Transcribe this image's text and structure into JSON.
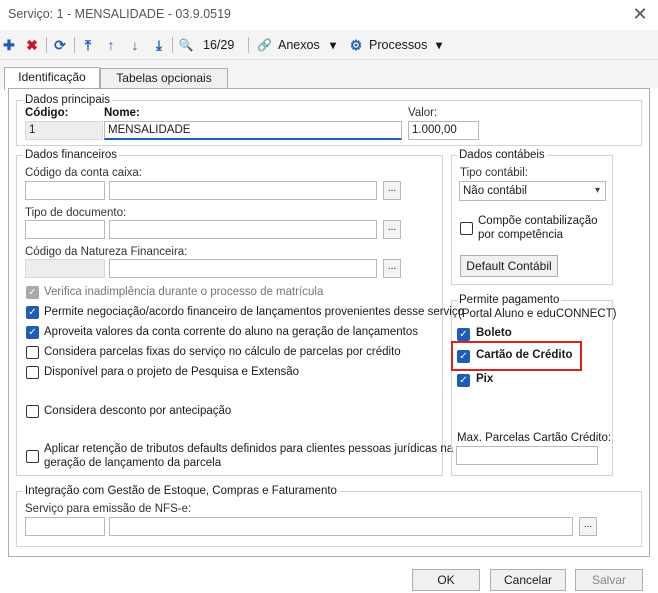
{
  "window": {
    "title": "Serviço: 1 - MENSALIDADE - 03.9.0519",
    "close_glyph": "✕"
  },
  "toolbar": {
    "add_glyph": "✚",
    "delete_glyph": "✖",
    "refresh_glyph": "⟳",
    "first_glyph": "⤒",
    "prev_glyph": "↑",
    "next_glyph": "↓",
    "last_glyph": "⤓",
    "search_glyph": "🔍",
    "record_counter": "16/29",
    "attach_glyph": "🔗",
    "attachments_label": "Anexos",
    "dropdown_glyph": "▾",
    "process_glyph": "⚙",
    "processes_label": "Processos"
  },
  "tabs": [
    {
      "label": "Identificação"
    },
    {
      "label": "Tabelas opcionais"
    }
  ],
  "main_data": {
    "group_label": "Dados principais",
    "code_label": "Código:",
    "code_value": "1",
    "name_label": "Nome:",
    "name_value": "MENSALIDADE",
    "value_label": "Valor:",
    "value_value": "1.000,00"
  },
  "financial": {
    "group_label": "Dados financeiros",
    "cash_account_label": "Código da conta caixa:",
    "document_type_label": "Tipo de documento:",
    "nature_label": "Código da Natureza Financeira:",
    "lookup_glyph": "...",
    "options": [
      {
        "label": "Verifica inadimplência durante o processo de matrícula",
        "checked": true,
        "disabled": true
      },
      {
        "label": "Permite negociação/acordo financeiro de lançamentos provenientes desse serviço",
        "checked": true,
        "disabled": false
      },
      {
        "label": "Aproveita valores da conta corrente do aluno na geração de lançamentos",
        "checked": true,
        "disabled": false
      },
      {
        "label": "Considera parcelas fixas do serviço no cálculo de parcelas por crédito",
        "checked": false,
        "disabled": false
      },
      {
        "label": "Disponível para o projeto de Pesquisa e Extensão",
        "checked": false,
        "disabled": false
      },
      {
        "label": "Considera desconto por antecipação",
        "checked": false,
        "disabled": false
      }
    ],
    "tax_option_line1": "Aplicar retenção de tributos defaults definidos para clientes pessoas jurídicas na",
    "tax_option_line2": "geração de lançamento da parcela"
  },
  "accounting": {
    "group_label": "Dados contábeis",
    "type_label": "Tipo contábil:",
    "type_value": "Não contábil",
    "compose_line1": "Compõe contabilização",
    "compose_line2": "por competência",
    "default_button": "Default Contábil"
  },
  "payment": {
    "group_label": "Permite pagamento",
    "subtitle": "(Portal Aluno e eduCONNECT)",
    "options": [
      {
        "label": "Boleto",
        "checked": true
      },
      {
        "label": "Cartão de Crédito",
        "checked": true
      },
      {
        "label": "Pix",
        "checked": true
      }
    ],
    "max_installments_label": "Max. Parcelas Cartão Crédito:"
  },
  "integration": {
    "group_label": "Integração com Gestão de Estoque, Compras e Faturamento",
    "nfse_label": "Serviço para emissão de NFS-e:"
  },
  "footer": {
    "ok": "OK",
    "cancel": "Cancelar",
    "save": "Salvar"
  },
  "colors": {
    "accent": "#1e5eb8",
    "highlight": "#e02020",
    "delete": "#c8102e"
  },
  "check_glyph": "✓"
}
